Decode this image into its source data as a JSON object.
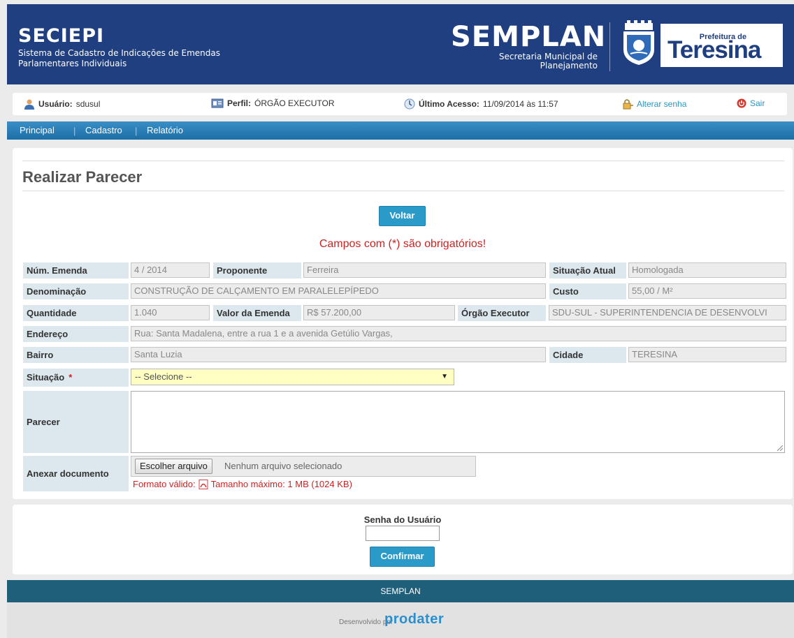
{
  "header": {
    "app_title": "SECIEPI",
    "app_subtitle": "Sistema de Cadastro de Indicações de Emendas Parlamentares Individuais",
    "org_title": "SEMPLAN",
    "org_subtitle": "Secretaria Municipal de Planejamento",
    "pref_small": "Prefeitura de",
    "pref_big": "Teresina"
  },
  "userbar": {
    "user_label": "Usuário:",
    "user_value": "sdusul",
    "profile_label": "Perfil:",
    "profile_value": "ÓRGÃO EXECUTOR",
    "access_label": "Último Acesso:",
    "access_value": "11/09/2014 às 11:57",
    "change_password": "Alterar senha",
    "logout": "Sair"
  },
  "nav": {
    "items": [
      "Principal",
      "Cadastro",
      "Relatório"
    ]
  },
  "page": {
    "title": "Realizar Parecer",
    "back_button": "Voltar",
    "required_note": "Campos com (*) são obrigatórios!"
  },
  "form": {
    "num_emenda": {
      "label": "Núm. Emenda",
      "value": "4 / 2014"
    },
    "proponente": {
      "label": "Proponente",
      "value": "Ferreira"
    },
    "situacao_atual": {
      "label": "Situação Atual",
      "value": "Homologada"
    },
    "denominacao": {
      "label": "Denominação",
      "value": "CONSTRUÇÃO DE CALÇAMENTO EM PARALELEPÍPEDO"
    },
    "custo": {
      "label": "Custo",
      "value": "55,00 / M²"
    },
    "quantidade": {
      "label": "Quantidade",
      "value": "1.040"
    },
    "valor_emenda": {
      "label": "Valor da Emenda",
      "value": "R$ 57.200,00"
    },
    "orgao_executor": {
      "label": "Órgão Executor",
      "value": "SDU-SUL - SUPERINTENDENCIA DE DESENVOLVI"
    },
    "endereco": {
      "label": "Endereço",
      "value": "Rua: Santa Madalena, entre a rua 1 e a avenida Getúlio Vargas,"
    },
    "bairro": {
      "label": "Bairro",
      "value": "Santa Luzia"
    },
    "cidade": {
      "label": "Cidade",
      "value": "TERESINA"
    },
    "situacao": {
      "label": "Situação",
      "required_mark": "*",
      "selected": "-- Selecione --"
    },
    "parecer": {
      "label": "Parecer",
      "value": ""
    },
    "anexo": {
      "label": "Anexar documento",
      "button": "Escolher arquivo",
      "status": "Nenhum arquivo selecionado",
      "format_label": "Formato válido:",
      "size_note": "Tamanho máximo: 1 MB (1024 KB)"
    }
  },
  "confirm": {
    "password_label": "Senha do Usuário",
    "confirm_button": "Confirmar"
  },
  "footer": {
    "text": "SEMPLAN",
    "developed_by": "Desenvolvido por",
    "developer": "prodater"
  },
  "colors": {
    "header_bg": "#1f3f80",
    "nav_bg": "#1c6ea5",
    "accent_button": "#2a9ac9",
    "required_red": "#cc2222",
    "label_bg": "#dce8ee",
    "select_bg": "#ffffc4",
    "footer_bg": "#1f5f7a"
  }
}
